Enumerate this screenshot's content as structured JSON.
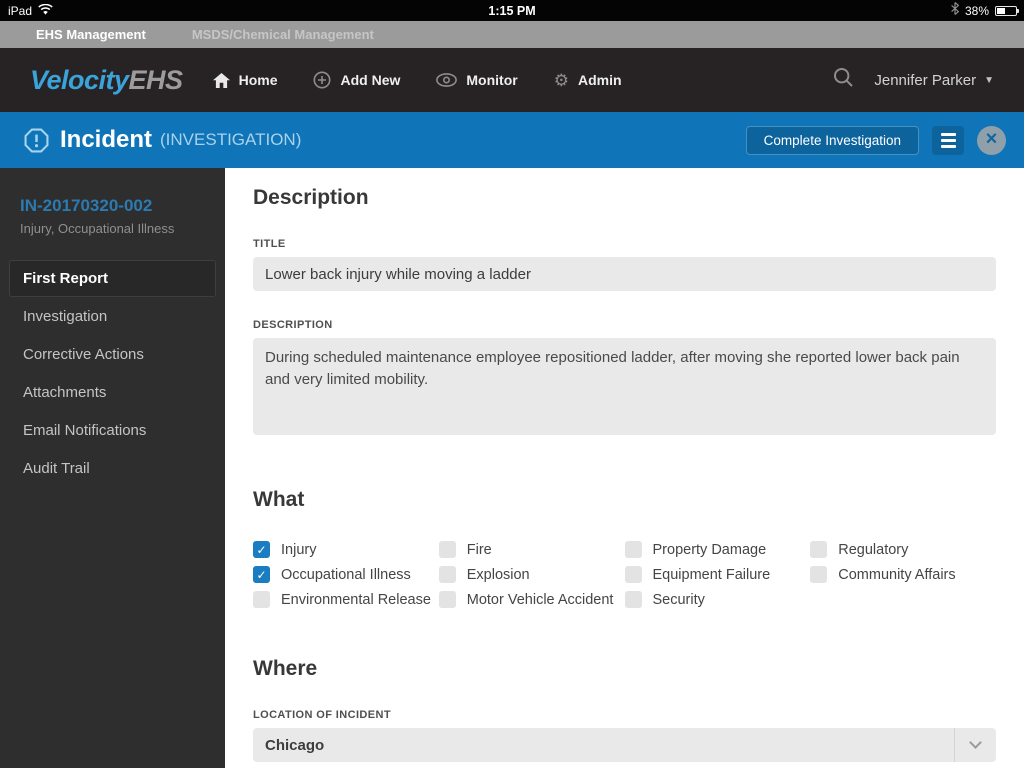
{
  "status_bar": {
    "device_label": "iPad",
    "time": "1:15 PM",
    "battery_percent": "38%"
  },
  "tab_bar": {
    "tabs": [
      {
        "label": "EHS Management",
        "active": true
      },
      {
        "label": "MSDS/Chemical Management",
        "active": false
      }
    ]
  },
  "nav_bar": {
    "logo_part1": "Velocity",
    "logo_part2": "EHS",
    "items": [
      {
        "label": "Home",
        "icon": "home-icon"
      },
      {
        "label": "Add New",
        "icon": "add-icon"
      },
      {
        "label": "Monitor",
        "icon": "monitor-icon"
      },
      {
        "label": "Admin",
        "icon": "admin-icon"
      }
    ],
    "user_name": "Jennifer Parker"
  },
  "page_header": {
    "title": "Incident",
    "subtitle": "(INVESTIGATION)",
    "complete_button_label": "Complete Investigation"
  },
  "sidebar": {
    "record_id": "IN-20170320-002",
    "record_subtitle": "Injury, Occupational Illness",
    "items": [
      {
        "label": "First Report",
        "active": true
      },
      {
        "label": "Investigation",
        "active": false
      },
      {
        "label": "Corrective Actions",
        "active": false
      },
      {
        "label": "Attachments",
        "active": false
      },
      {
        "label": "Email Notifications",
        "active": false
      },
      {
        "label": "Audit Trail",
        "active": false
      }
    ]
  },
  "main": {
    "description": {
      "heading": "Description",
      "title_label": "TITLE",
      "title_value": "Lower back injury while moving a ladder",
      "description_label": "DESCRIPTION",
      "description_value": "During scheduled maintenance employee repositioned ladder, after moving she reported lower back pain and very limited mobility."
    },
    "what": {
      "heading": "What",
      "columns": [
        {
          "items": [
            {
              "label": "Injury",
              "checked": true
            },
            {
              "label": "Occupational Illness",
              "checked": true
            },
            {
              "label": "Environmental Release",
              "checked": false
            }
          ]
        },
        {
          "items": [
            {
              "label": "Fire",
              "checked": false
            },
            {
              "label": "Explosion",
              "checked": false
            },
            {
              "label": "Motor Vehicle Accident",
              "checked": false
            }
          ]
        },
        {
          "items": [
            {
              "label": "Property Damage",
              "checked": false
            },
            {
              "label": "Equipment Failure",
              "checked": false
            },
            {
              "label": "Security",
              "checked": false
            }
          ]
        },
        {
          "items": [
            {
              "label": "Regulatory",
              "checked": false
            },
            {
              "label": "Community Affairs",
              "checked": false
            }
          ]
        }
      ]
    },
    "where": {
      "heading": "Where",
      "location_label": "LOCATION OF INCIDENT",
      "location_value": "Chicago"
    }
  },
  "colors": {
    "header_blue": "#0f74b8",
    "accent_blue": "#1a7dc1",
    "nav_dark": "#272324",
    "sidebar_dark": "#2e2e2e",
    "tab_gray": "#9b9b9b",
    "field_gray": "#e9e9e9"
  }
}
